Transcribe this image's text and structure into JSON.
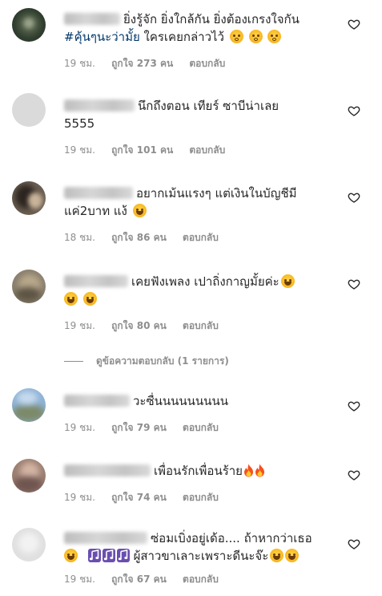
{
  "comments": [
    {
      "username": "​",
      "text_parts": [
        "ยิ่งรู้จัก ยิ่งใกล้กัน ยิ่งต้องเกรงใจกัน",
        "#คุ้นๆนะว่ามั้ย",
        " ใครเคยกล่าวไว้"
      ],
      "time": "19 ชม.",
      "likes": "ถูกใจ 273 คน",
      "reply": "ตอบกลับ"
    },
    {
      "text_parts": [
        "นึกถึงตอน เทียร์ ซาบีน่าเลย",
        "5555"
      ],
      "time": "19 ชม.",
      "likes": "ถูกใจ 101 คน",
      "reply": "ตอบกลับ"
    },
    {
      "text_parts": [
        "อยากเม้นแรงๆ แต่เงินในบัญชีมี",
        "แค่2บาท แง้"
      ],
      "time": "18 ชม.",
      "likes": "ถูกใจ 86 คน",
      "reply": "ตอบกลับ"
    },
    {
      "text_parts": [
        "เคยฟังเพลง เปาถิ่งกาญมั้ยค่ะ"
      ],
      "time": "19 ชม.",
      "likes": "ถูกใจ 80 คน",
      "reply": "ตอบกลับ"
    },
    {
      "text_parts": [
        "วะซื่นนนนนนนนน"
      ],
      "time": "19 ชม.",
      "likes": "ถูกใจ 79 คน",
      "reply": "ตอบกลับ"
    },
    {
      "text_parts": [
        "เพื่อนรักเพื่อนร้าย"
      ],
      "time": "19 ชม.",
      "likes": "ถูกใจ 74 คน",
      "reply": "ตอบกลับ"
    },
    {
      "text_parts": [
        "ซ่อมเบิ่งอยู่เด้อ.... ถ้าหากว่าเธอ",
        "ผู้สาวขาเลาะเพราะดีนะจ๊ะ"
      ],
      "time": "19 ชม.",
      "likes": "ถูกใจ 67 คน",
      "reply": "ตอบกลับ"
    }
  ],
  "view_replies": "ดูข้อความตอบกลับ (1 รายการ)",
  "icons": {
    "like": "heart-outline-icon",
    "emoji_sad": "crying-face-icon",
    "emoji_laugh": "rolling-laughing-icon",
    "emoji_fire": "fire-icon",
    "emoji_notes": "music-notes-icon",
    "emoji_grin": "grinning-squint-icon"
  },
  "colors": {
    "text": "#262626",
    "meta": "#8e8e8e",
    "hashtag": "#00376b"
  }
}
